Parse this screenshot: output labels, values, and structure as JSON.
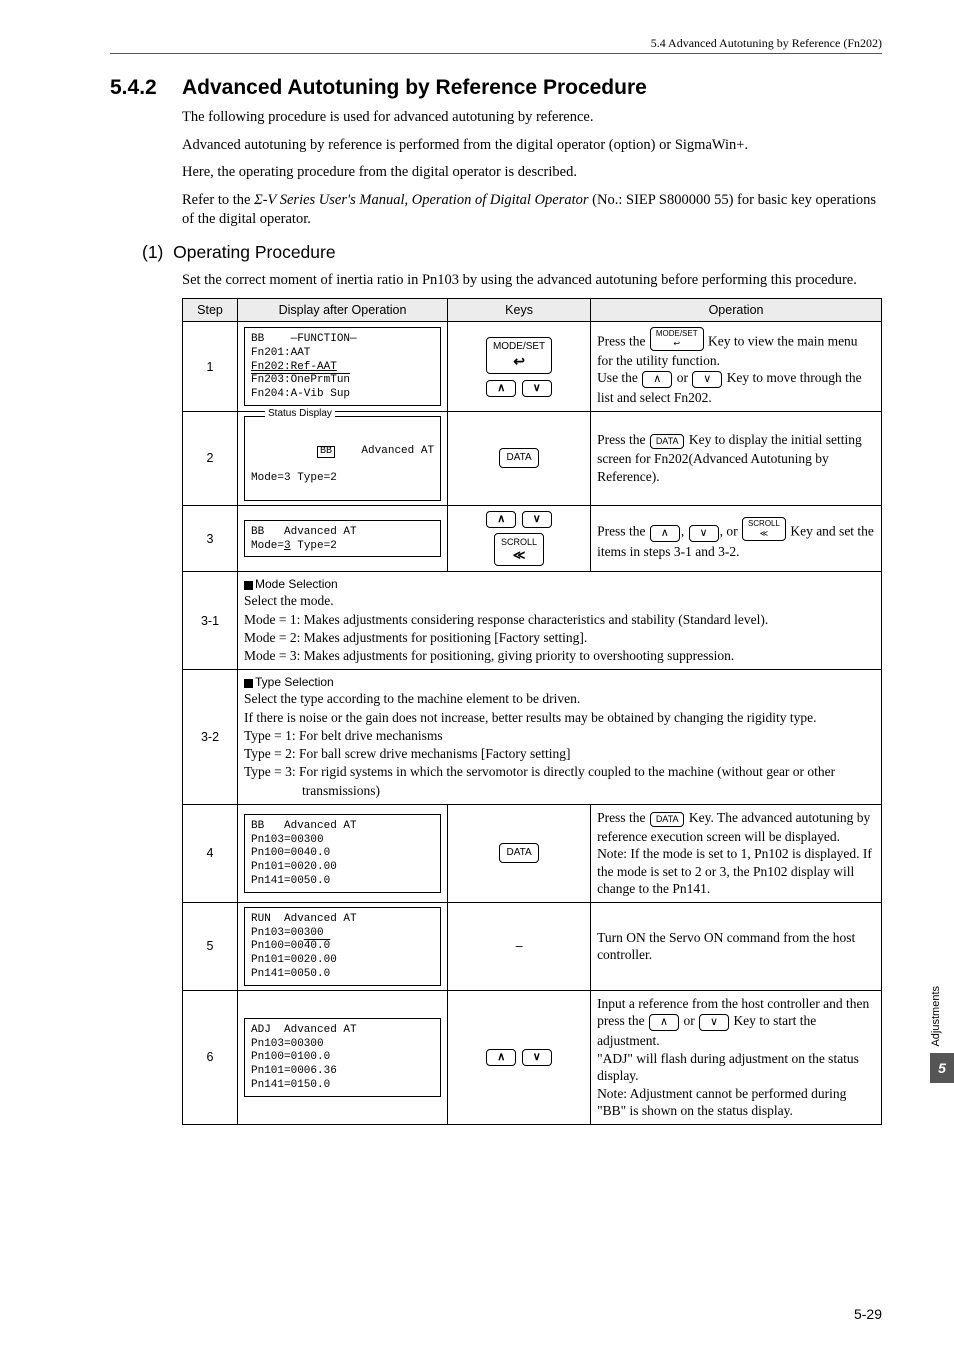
{
  "header": "5.4  Advanced Autotuning by Reference (Fn202)",
  "title_num": "5.4.2",
  "title_text": "Advanced Autotuning by Reference Procedure",
  "intro1": "The following procedure is used for advanced autotuning by reference.",
  "intro2": "Advanced autotuning by reference is performed from the digital operator (option) or SigmaWin+.",
  "intro3": "Here, the operating procedure from the digital operator is described.",
  "intro4a": "Refer to the ",
  "intro4b": "Σ-V Series User's Manual, Operation of Digital Operator",
  "intro4c": " (No.: SIEP S800000 55) for basic key operations of the digital operator.",
  "sub_num": "(1)",
  "sub_title": "Operating Procedure",
  "sub_intro": "Set the correct moment of inertia ratio in Pn103 by using the advanced autotuning before performing this procedure.",
  "cols": {
    "step": "Step",
    "display": "Display after Operation",
    "keys": "Keys",
    "operation": "Operation"
  },
  "rows": {
    "r1": {
      "step": "1",
      "disp_title": "—FUNCTION—",
      "disp_l1": "BB",
      "disp_l2": "Fn201:AAT",
      "disp_l3": "Fn202:Ref-AAT",
      "disp_l4": "Fn203:OnePrmTun",
      "disp_l5": "Fn204:A-Vib Sup",
      "key1": "MODE/SET",
      "key_arrow": "↩",
      "op1": "Press the ",
      "op2": " Key to view the main menu for the utility function.",
      "op3": "Use the ",
      "op4": " or ",
      "op5": " Key to move through the list and select Fn202."
    },
    "r2": {
      "step": "2",
      "status": "Status Display",
      "disp_l1": "BB",
      "disp_l1b": "    Advanced AT",
      "disp_l2": "Mode=3 Type=2",
      "key": "DATA",
      "op1": "Press the ",
      "op2": " Key to display the initial setting screen for Fn202(Advanced Autotuning by Reference)."
    },
    "r3": {
      "step": "3",
      "disp_l1": "BB   Advanced AT",
      "disp_l2": "Mode=3 Type=2",
      "key_scroll": "SCROLL",
      "op1": "Press the ",
      "op2": ", ",
      "op3": ", or ",
      "op4": " Key and set the items in steps 3-1 and 3-2."
    },
    "r31": {
      "step": "3-1",
      "hd": "Mode Selection",
      "l1": "Select the mode.",
      "l2": "Mode = 1: Makes adjustments considering response characteristics and stability (Standard level).",
      "l3": "Mode = 2: Makes adjustments for positioning [Factory setting].",
      "l4": "Mode = 3: Makes adjustments for positioning, giving priority to overshooting suppression."
    },
    "r32": {
      "step": "3-2",
      "hd": "Type Selection",
      "l1": "Select the type according to the machine element to be driven.",
      "l2": "If there is noise or the gain does not increase, better results may be obtained by changing the rigidity type.",
      "l3": "Type = 1: For belt drive mechanisms",
      "l4": "Type = 2: For ball screw drive mechanisms [Factory setting]",
      "l5": "Type = 3: For rigid systems in which the servomotor is directly coupled to the machine (without gear or other",
      "l5b": "transmissions)"
    },
    "r4": {
      "step": "4",
      "disp_l1": "BB   Advanced AT",
      "disp_l2": "Pn103=00300",
      "disp_l3": "Pn100=0040.0",
      "disp_l4": "Pn101=0020.00",
      "disp_l5": "Pn141=0050.0",
      "key": "DATA",
      "op1": "Press the ",
      "op2": " Key. The advanced autotuning by reference execution screen will be displayed.",
      "op3": "Note: If the mode is set to 1, Pn102 is displayed. If the mode is set to 2 or 3, the Pn102 display will change to the Pn141."
    },
    "r5": {
      "step": "5",
      "disp_l1": "RUN  Advanced AT",
      "disp_l2": "Pn103=00300",
      "disp_l3": "Pn100=0040.0",
      "disp_l4": "Pn101=0020.00",
      "disp_l5": "Pn141=0050.0",
      "keys": "–",
      "op": "Turn ON the Servo ON command from the host controller."
    },
    "r6": {
      "step": "6",
      "disp_l1": "ADJ  Advanced AT",
      "disp_l2": "Pn103=00300",
      "disp_l3": "Pn100=0100.0",
      "disp_l4": "Pn101=0006.36",
      "disp_l5": "Pn141=0150.0",
      "op1": "Input a reference from the host controller and then press the ",
      "op2": " or ",
      "op3": " Key to start the adjustment.",
      "op4": "\"ADJ\" will flash during adjustment on the status display.",
      "op5": "Note: Adjustment cannot be performed during \"BB\" is shown on the status display."
    }
  },
  "side_label": "Adjustments",
  "side_num": "5",
  "page": "5-29"
}
